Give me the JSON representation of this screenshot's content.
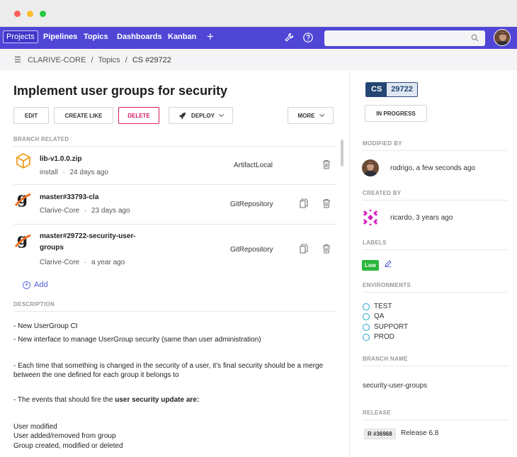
{
  "nav": {
    "items": [
      "Projects",
      "Pipelines",
      "Topics",
      "Dashboards",
      "Kanban"
    ],
    "plus": "+",
    "search_placeholder": "",
    "icons": [
      "wrench-icon",
      "help-icon",
      "search-icon"
    ]
  },
  "breadcrumb": {
    "items": [
      "CLARIVE-CORE",
      "/",
      "Topics",
      "/",
      "CS #29722"
    ]
  },
  "topic": {
    "title": "Implement user groups for security",
    "buttons": {
      "edit": "EDIT",
      "create_like": "CREATE LIKE",
      "delete": "DELETE",
      "deploy": "DEPLOY",
      "more": "MORE"
    }
  },
  "branches": {
    "heading": "BRANCH RELATED",
    "items": [
      {
        "name": "lib-v1.0.0.zip",
        "name2": "",
        "sub": "install",
        "age": "24 days ago",
        "type": "ArtifactLocal"
      },
      {
        "name": "master#33793-cla",
        "name2": "",
        "sub": "Clarive-Core",
        "age": "23 days ago",
        "type": "GitRepository"
      },
      {
        "name": "master#29722-security-user-",
        "name2": "groups",
        "sub": "Clarive-Core",
        "age": "a year ago",
        "type": "GitRepository"
      }
    ],
    "sep": "·",
    "add": "Add"
  },
  "description": {
    "heading": "DESCRIPTION",
    "line1": "- New UserGroup CI",
    "line2": "- New interface to manage UserGroup security (same than user administration)",
    "line3a": "- Each time that something is changed in the security of a user, it's final security should be a merge",
    "line3b": "between the one defined for each group it belongs to",
    "line4_prefix": "- The events that should fire the ",
    "line4_bold": "user security update are:",
    "line5": "User modified",
    "line6": "User added/removed from group",
    "line7": "Group created, modified or deleted"
  },
  "sidebar": {
    "badge_type": "CS",
    "badge_number": "29722",
    "status": "IN PROGRESS",
    "modified_by_heading": "MODIFIED BY",
    "modified_by": "rodrigo, a few seconds ago",
    "created_by_heading": "CREATED BY",
    "created_by": "ricardo, 3 years ago",
    "labels_heading": "LABELS",
    "label": "Low",
    "environments_heading": "ENVIRONMENTS",
    "environments": [
      "TEST",
      "QA",
      "SUPPORT",
      "PROD"
    ],
    "branch_name_heading": "BRANCH NAME",
    "branch_name": "security-user-groups",
    "release_heading": "RELEASE",
    "release_badge": "R #36968",
    "release_name": "Release 6.8"
  },
  "colors": {
    "nav_bg": "#4f46d6",
    "delete": "#d81a66",
    "label_low": "#2bb73d",
    "cs_badge": "#244573",
    "link": "#4a5bd0"
  }
}
